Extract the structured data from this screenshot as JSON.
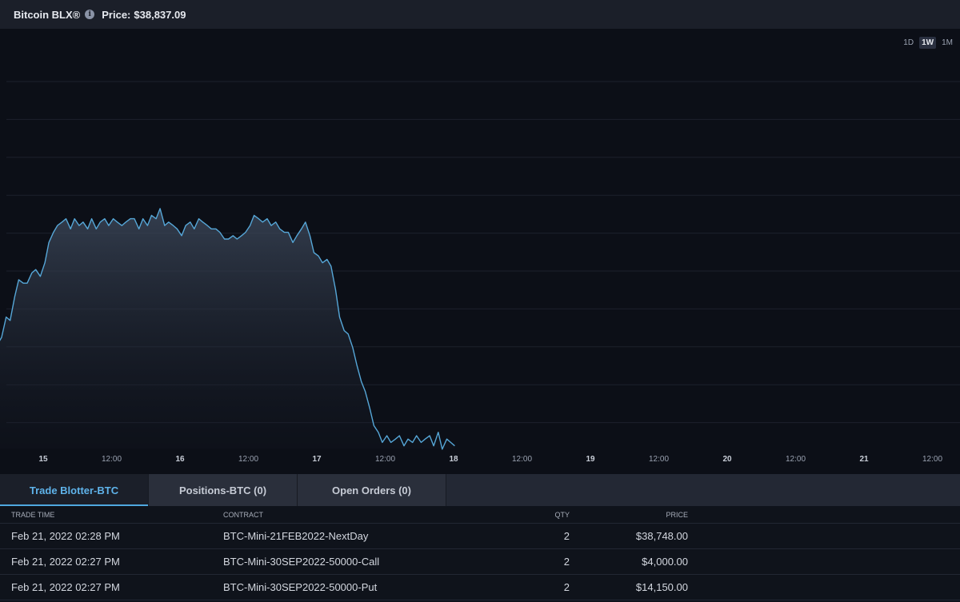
{
  "header": {
    "title": "Bitcoin BLX®",
    "price_label": "Price:",
    "price_value": "$38,837.09"
  },
  "chart": {
    "ranges": [
      "1D",
      "1W",
      "1M"
    ],
    "active_range": "1W"
  },
  "chart_data": {
    "type": "area",
    "title": "",
    "xlabel": "",
    "ylabel": "",
    "grid": true,
    "x_ticks": [
      {
        "label": "15",
        "bold": true
      },
      {
        "label": "12:00",
        "bold": false
      },
      {
        "label": "16",
        "bold": true
      },
      {
        "label": "12:00",
        "bold": false
      },
      {
        "label": "17",
        "bold": true
      },
      {
        "label": "12:00",
        "bold": false
      },
      {
        "label": "18",
        "bold": true
      },
      {
        "label": "12:00",
        "bold": false
      },
      {
        "label": "19",
        "bold": true
      },
      {
        "label": "12:00",
        "bold": false
      },
      {
        "label": "20",
        "bold": true
      },
      {
        "label": "12:00",
        "bold": false
      },
      {
        "label": "21",
        "bold": true
      },
      {
        "label": "12:00",
        "bold": false
      }
    ],
    "x_range_hours": [
      -11,
      72.2
    ],
    "y_range": [
      0,
      100
    ],
    "series": [
      {
        "color": "#56a7d8",
        "values": [
          [
            -11,
            30
          ],
          [
            -10.3,
            25
          ],
          [
            -9.5,
            20
          ],
          [
            -8.7,
            21
          ],
          [
            -8,
            23
          ],
          [
            -7.3,
            25
          ],
          [
            -6.5,
            31
          ],
          [
            -5.8,
            30
          ],
          [
            -5,
            37
          ],
          [
            -4.3,
            42
          ],
          [
            -3.5,
            41
          ],
          [
            -2.8,
            41
          ],
          [
            -2,
            44
          ],
          [
            -1.3,
            45
          ],
          [
            -0.5,
            43
          ],
          [
            0.3,
            47
          ],
          [
            1,
            53
          ],
          [
            1.8,
            56
          ],
          [
            2.5,
            58
          ],
          [
            3.3,
            59
          ],
          [
            4,
            60
          ],
          [
            4.8,
            57
          ],
          [
            5.5,
            60
          ],
          [
            6.3,
            58
          ],
          [
            7,
            59
          ],
          [
            7.8,
            57
          ],
          [
            8.5,
            60
          ],
          [
            9.3,
            57
          ],
          [
            10,
            59
          ],
          [
            10.8,
            60
          ],
          [
            11.5,
            58
          ],
          [
            12.3,
            60
          ],
          [
            13,
            59
          ],
          [
            13.8,
            58
          ],
          [
            14.5,
            59
          ],
          [
            15.3,
            60
          ],
          [
            16,
            60
          ],
          [
            16.8,
            57
          ],
          [
            17.5,
            60
          ],
          [
            18.3,
            58
          ],
          [
            19,
            61
          ],
          [
            19.8,
            60
          ],
          [
            20.5,
            63
          ],
          [
            21.3,
            58
          ],
          [
            22,
            59
          ],
          [
            22.8,
            58
          ],
          [
            23.5,
            57
          ],
          [
            24.3,
            55
          ],
          [
            25,
            58
          ],
          [
            25.8,
            59
          ],
          [
            26.5,
            57
          ],
          [
            27.3,
            60
          ],
          [
            28,
            59
          ],
          [
            28.8,
            58
          ],
          [
            29.5,
            57
          ],
          [
            30.3,
            57
          ],
          [
            31,
            56
          ],
          [
            31.8,
            54
          ],
          [
            32.5,
            54
          ],
          [
            33.3,
            55
          ],
          [
            34,
            54
          ],
          [
            34.8,
            55
          ],
          [
            35.5,
            56
          ],
          [
            36.3,
            58
          ],
          [
            37,
            61
          ],
          [
            37.8,
            60
          ],
          [
            38.5,
            59
          ],
          [
            39.3,
            60
          ],
          [
            40,
            58
          ],
          [
            40.8,
            59
          ],
          [
            41.5,
            57
          ],
          [
            42.3,
            56
          ],
          [
            43,
            56
          ],
          [
            43.8,
            53
          ],
          [
            44.5,
            55
          ],
          [
            45.3,
            57
          ],
          [
            46,
            59
          ],
          [
            46.8,
            55
          ],
          [
            47.5,
            50
          ],
          [
            48.3,
            49
          ],
          [
            49,
            47
          ],
          [
            49.8,
            48
          ],
          [
            50.5,
            46
          ],
          [
            51.3,
            39
          ],
          [
            52,
            31
          ],
          [
            52.8,
            27
          ],
          [
            53.5,
            26
          ],
          [
            54.3,
            22
          ],
          [
            55,
            17
          ],
          [
            55.8,
            12
          ],
          [
            56.5,
            9
          ],
          [
            57.3,
            4
          ],
          [
            58,
            -1
          ],
          [
            58.8,
            -3
          ],
          [
            59.5,
            -6
          ],
          [
            60.3,
            -4
          ],
          [
            61,
            -6
          ],
          [
            61.8,
            -5
          ],
          [
            62.5,
            -4
          ],
          [
            63.3,
            -7
          ],
          [
            64,
            -5
          ],
          [
            64.8,
            -6
          ],
          [
            65.5,
            -4
          ],
          [
            66.3,
            -6
          ],
          [
            67,
            -5
          ],
          [
            67.8,
            -4
          ],
          [
            68.5,
            -7
          ],
          [
            69.3,
            -3
          ],
          [
            70,
            -8
          ],
          [
            70.8,
            -5
          ],
          [
            71.5,
            -6
          ],
          [
            72.2,
            -7
          ]
        ]
      }
    ]
  },
  "tabs": [
    {
      "label": "Trade Blotter-BTC",
      "active": true
    },
    {
      "label": "Positions-BTC (0)",
      "active": false
    },
    {
      "label": "Open Orders (0)",
      "active": false
    }
  ],
  "table": {
    "columns": [
      "TRADE TIME",
      "CONTRACT",
      "QTY",
      "PRICE"
    ],
    "rows": [
      {
        "time": "Feb 21, 2022 02:28 PM",
        "contract": "BTC-Mini-21FEB2022-NextDay",
        "qty": "2",
        "price": "$38,748.00"
      },
      {
        "time": "Feb 21, 2022 02:27 PM",
        "contract": "BTC-Mini-30SEP2022-50000-Call",
        "qty": "2",
        "price": "$4,000.00"
      },
      {
        "time": "Feb 21, 2022 02:27 PM",
        "contract": "BTC-Mini-30SEP2022-50000-Put",
        "qty": "2",
        "price": "$14,150.00"
      }
    ]
  }
}
